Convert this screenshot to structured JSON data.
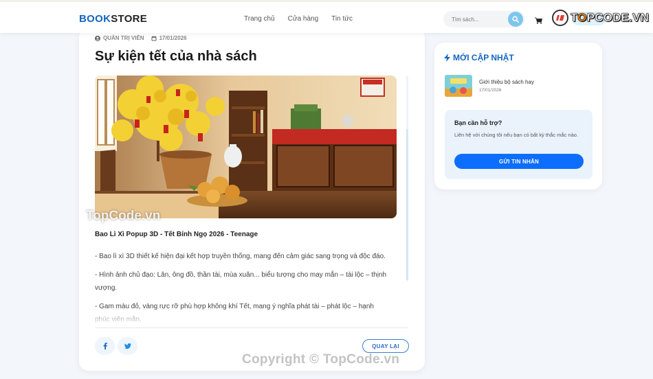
{
  "header": {
    "logo_part1": "BOOK",
    "logo_part2": "STORE",
    "nav": [
      "Trang chủ",
      "Cửa hàng",
      "Tin tức"
    ],
    "search_placeholder": "Tìm sách...",
    "brand_prefix": "T",
    "brand_o": "O",
    "brand_suffix": "PCODE.VN"
  },
  "article": {
    "author": "QUẢN TRỊ VIÊN",
    "date": "17/01/2026",
    "title": "Sự kiện tết của nhà sách",
    "heading": "Bao Lì Xì Popup 3D - Tết Bính Ngọ 2026 - Teenage",
    "paragraphs": [
      "- Bao lì xì 3D thiết kế hiện đại kết hợp truyền thống, mang đến cảm giác sang trọng và độc đáo.",
      "- Hình ảnh chủ đạo: Lân, ông đồ, thần tài, mùa xuân... biểu tượng cho may mắn – tài lộc – thịnh vượng.",
      "- Gam màu đỏ, vàng rực rỡ phù hợp không khí Tết, mang ý nghĩa phát tài – phát lộc – hạnh phúc viên mãn."
    ],
    "back_label": "QUAY LẠI"
  },
  "sidebar": {
    "title": "MỚI CẬP NHẬT",
    "news": [
      {
        "title": "Giới thiệu bộ sách hay",
        "date": "17/01/2026"
      }
    ],
    "support": {
      "heading": "Bạn cần hỗ trợ?",
      "text": "Liên hệ với chúng tôi nếu bạn có bất kỳ thắc mắc nào.",
      "button": "GỬI TIN NHẮN"
    }
  },
  "watermarks": {
    "image_mark": "TopCode.vn",
    "copyright": "Copyright © TopCode.vn"
  },
  "colors": {
    "brand_blue": "#1565c0",
    "button_blue": "#0d6efd",
    "search_button": "#7dc6ee"
  },
  "icons": [
    "user-icon",
    "calendar-icon",
    "search-icon",
    "cart-icon",
    "bolt-icon",
    "facebook-icon",
    "twitter-icon"
  ]
}
